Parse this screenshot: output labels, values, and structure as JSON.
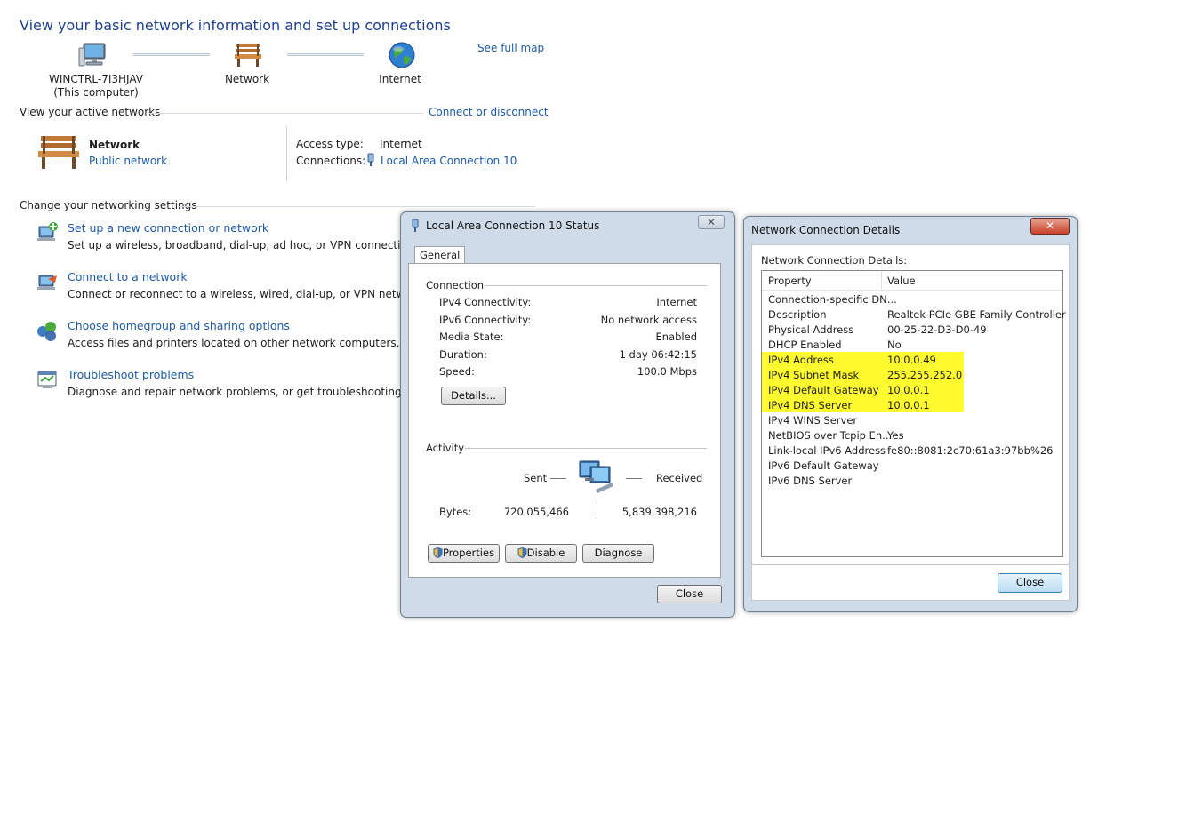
{
  "page": {
    "title": "View your basic network information and set up connections",
    "see_full_map": "See full map"
  },
  "map": {
    "computer_name": "WINCTRL-7I3HJAV",
    "computer_sub": "(This computer)",
    "network": "Network",
    "internet": "Internet"
  },
  "active": {
    "heading": "View your active networks",
    "connect_link": "Connect or disconnect",
    "network_name": "Network",
    "network_type": "Public network",
    "access_label": "Access type:",
    "access_value": "Internet",
    "connections_label": "Connections:",
    "connections_value": "Local Area Connection 10"
  },
  "settings": {
    "heading": "Change your networking settings",
    "items": [
      {
        "title": "Set up a new connection or network",
        "desc": "Set up a wireless, broadband, dial-up, ad hoc, or VPN connection; or se",
        "icon": "new-connection-icon"
      },
      {
        "title": "Connect to a network",
        "desc": "Connect or reconnect to a wireless, wired, dial-up, or VPN network con",
        "icon": "connect-network-icon"
      },
      {
        "title": "Choose homegroup and sharing options",
        "desc": "Access files and printers located on other network computers, or chang",
        "icon": "homegroup-icon"
      },
      {
        "title": "Troubleshoot problems",
        "desc": "Diagnose and repair network problems, or get troubleshooting informa",
        "icon": "troubleshoot-icon"
      }
    ]
  },
  "status_dialog": {
    "title": "Local Area Connection 10 Status",
    "tab": "General",
    "connection_group": "Connection",
    "rows": [
      {
        "label": "IPv4 Connectivity:",
        "value": "Internet"
      },
      {
        "label": "IPv6 Connectivity:",
        "value": "No network access"
      },
      {
        "label": "Media State:",
        "value": "Enabled"
      },
      {
        "label": "Duration:",
        "value": "1 day 06:42:15"
      },
      {
        "label": "Speed:",
        "value": "100.0 Mbps"
      }
    ],
    "details_button": "Details...",
    "activity_group": "Activity",
    "sent_label": "Sent",
    "received_label": "Received",
    "bytes_label": "Bytes:",
    "bytes_sent": "720,055,466",
    "bytes_received": "5,839,398,216",
    "properties_button": "Properties",
    "disable_button": "Disable",
    "diagnose_button": "Diagnose",
    "close_button": "Close",
    "close_glyph": "✕"
  },
  "details_dialog": {
    "title": "Network Connection Details",
    "caption": "Network Connection Details:",
    "col_property": "Property",
    "col_value": "Value",
    "highlight_color": "#fffb2e",
    "rows": [
      {
        "property": "Connection-specific DN...",
        "value": "",
        "highlighted": false
      },
      {
        "property": "Description",
        "value": "Realtek PCIe GBE Family Controller",
        "highlighted": false
      },
      {
        "property": "Physical Address",
        "value": "00-25-22-D3-D0-49",
        "highlighted": false
      },
      {
        "property": "DHCP Enabled",
        "value": "No",
        "highlighted": false
      },
      {
        "property": "IPv4 Address",
        "value": "10.0.0.49",
        "highlighted": true
      },
      {
        "property": "IPv4 Subnet Mask",
        "value": "255.255.252.0",
        "highlighted": true
      },
      {
        "property": "IPv4 Default Gateway",
        "value": "10.0.0.1",
        "highlighted": true
      },
      {
        "property": "IPv4 DNS Server",
        "value": "10.0.0.1",
        "highlighted": true
      },
      {
        "property": "IPv4 WINS Server",
        "value": "",
        "highlighted": false
      },
      {
        "property": "NetBIOS over Tcpip En...",
        "value": "Yes",
        "highlighted": false
      },
      {
        "property": "Link-local IPv6 Address",
        "value": "fe80::8081:2c70:61a3:97bb%26",
        "highlighted": false
      },
      {
        "property": "IPv6 Default Gateway",
        "value": "",
        "highlighted": false
      },
      {
        "property": "IPv6 DNS Server",
        "value": "",
        "highlighted": false
      }
    ],
    "close_button": "Close",
    "close_glyph": "✕"
  }
}
